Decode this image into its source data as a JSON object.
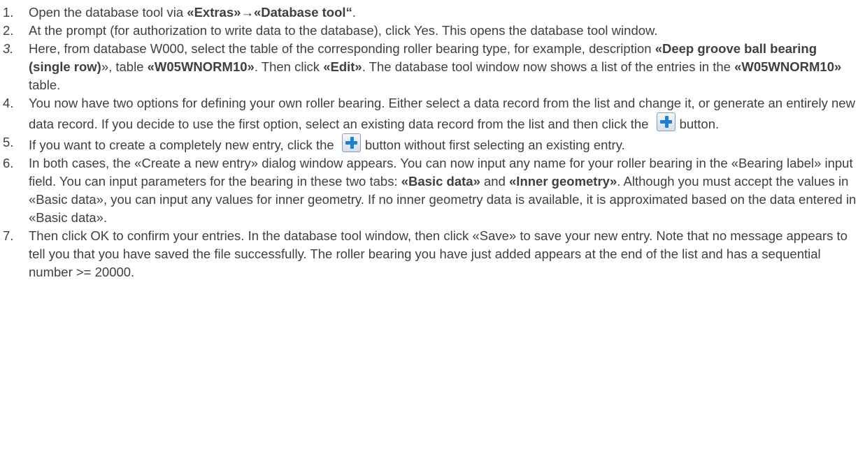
{
  "steps": [
    {
      "num": "1.",
      "parts": [
        {
          "t": "Open the database tool via "
        },
        {
          "t": "«Extras»",
          "b": true
        },
        {
          "t": "→",
          "b": true
        },
        {
          "t": "«Database tool“",
          "b": true
        },
        {
          "t": "."
        }
      ]
    },
    {
      "num": "2.",
      "parts": [
        {
          "t": "At the prompt (for authorization to write data to the database), click Yes. This opens the database tool window."
        }
      ]
    },
    {
      "num": "3.",
      "italic_num": true,
      "parts": [
        {
          "t": "Here, from database W000, select the table of the corresponding roller bearing type, for example, description "
        },
        {
          "t": "«Deep groove ball bearing (single row)",
          "b": true
        },
        {
          "t": "», table "
        },
        {
          "t": "«W05WNORM10»",
          "b": true
        },
        {
          "t": ". Then click "
        },
        {
          "t": "«Edit»",
          "b": true
        },
        {
          "t": ". The database tool window now shows a list of the entries in the "
        },
        {
          "t": "«W05WNORM10»",
          "b": true
        },
        {
          "t": " table."
        }
      ]
    },
    {
      "num": "4.",
      "parts": [
        {
          "t": "You now have two options for defining your own roller bearing. Either select a data record from the list and change it, or generate an entirely new data record. If you decide to use the first option, select an existing data record from the list and then click the "
        },
        {
          "icon": "plus-icon"
        },
        {
          "t": "button."
        }
      ]
    },
    {
      "num": "5.",
      "parts": [
        {
          "t": "If you want to create a completely new entry, click the "
        },
        {
          "icon": "plus-icon"
        },
        {
          "t": "button without first selecting an existing entry."
        }
      ]
    },
    {
      "num": "6.",
      "parts": [
        {
          "t": "In both cases, the «Create a new entry» dialog window appears. You can now input any name for your roller bearing in the «Bearing label» input field. You can input parameters for the bearing in these two tabs: "
        },
        {
          "t": "«Basic data»",
          "b": true
        },
        {
          "t": " and "
        },
        {
          "t": "«Inner geometry»",
          "b": true
        },
        {
          "t": ". Although you must accept the values in «Basic data», you can input any values for inner geometry. If no inner geometry data is available, it is approximated based on the data entered in «Basic data»."
        }
      ]
    },
    {
      "num": "7.",
      "parts": [
        {
          "t": "Then click OK to confirm your entries. In the database tool window, then click «Save» to save your new entry. Note that no message appears to tell you that you have saved the file successfully. The roller bearing you have just added appears at the end of the list and has a sequential number >= 20000."
        }
      ]
    }
  ]
}
